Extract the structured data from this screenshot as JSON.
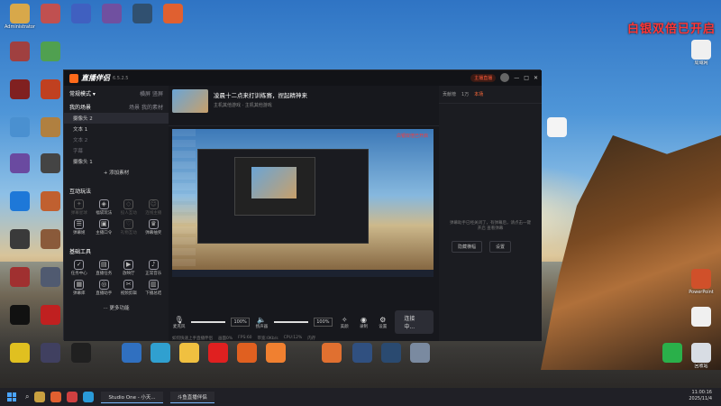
{
  "overlay_text": "白银双倍已开启",
  "desktop_left_icons": [
    {
      "label": "Administrator",
      "color": "#d8a84a"
    },
    {
      "label": "",
      "color": "#c05050"
    },
    {
      "label": "",
      "color": "#4060c0"
    },
    {
      "label": "",
      "color": "#7050a0"
    },
    {
      "label": "",
      "color": "#305070"
    },
    {
      "label": "",
      "color": "#e06030"
    }
  ],
  "desktop_right_icons": [
    {
      "label": "局域网"
    },
    {
      "label": ""
    },
    {
      "label": "PowerPoint"
    },
    {
      "label": ""
    },
    {
      "label": "回收站"
    }
  ],
  "app": {
    "name": "直播伴侣",
    "version": "6.5.2.5",
    "titlebar_promo": "主播直播",
    "titlebar_buttons": [
      "—",
      "□",
      "✕"
    ]
  },
  "left_panel": {
    "mode_label": "常规模式 ▾",
    "mode_tabs": [
      "横屏",
      "竖屏"
    ],
    "scenes_header": "我的场景",
    "scene_tabs": [
      "场景",
      "我的素材"
    ],
    "scenes": [
      {
        "label": "摄像头 2",
        "state": "sel"
      },
      {
        "label": "文本 1",
        "state": ""
      },
      {
        "label": "文本 2",
        "state": "dim"
      },
      {
        "label": "字幕",
        "state": "dim"
      },
      {
        "label": "摄像头 1",
        "state": ""
      }
    ],
    "add_source": "+ 添加素材",
    "interact_title": "互动玩法",
    "interact_tools": [
      {
        "label": "弹幕星球",
        "state": "dim"
      },
      {
        "label": "福袋玩法",
        "state": ""
      },
      {
        "label": "投人互动",
        "state": "dim"
      },
      {
        "label": "连线主播",
        "state": "dim"
      },
      {
        "label": "弹幕姬",
        "state": ""
      },
      {
        "label": "主播口令",
        "state": ""
      },
      {
        "label": "礼物互动",
        "state": "dim"
      },
      {
        "label": "弹幕抽奖",
        "state": ""
      }
    ],
    "basic_title": "基础工具",
    "basic_tools": [
      {
        "label": "任务中心",
        "state": ""
      },
      {
        "label": "直播任务",
        "state": ""
      },
      {
        "label": "放映厅",
        "state": ""
      },
      {
        "label": "正常音乐",
        "state": ""
      },
      {
        "label": "弹幕库",
        "state": ""
      },
      {
        "label": "直播助手",
        "state": ""
      },
      {
        "label": "视频剪辑",
        "state": ""
      },
      {
        "label": "下播总结",
        "state": ""
      }
    ],
    "more": "··· 更多功能"
  },
  "center": {
    "title": "凌晨十二点来打训练赛，捏起精神来",
    "category": "主机其他游戏 · 主机其他游戏",
    "preview_notice": "白银双倍已开启",
    "mic_label": "麦克风",
    "mic_pct": "100%",
    "speaker_label": "扬声器",
    "speaker_pct": "100%",
    "ctrl_icons": [
      "美颜",
      "录制",
      "设置"
    ],
    "start_button": "连接中...",
    "status_items": [
      "如何快速上手直播伴侣",
      "画面0%",
      "FPS:60",
      "带宽:0Kb/s",
      "CPU:12%",
      "内存"
    ]
  },
  "right_panel": {
    "rank_tabs": [
      "贡献榜",
      "1万"
    ],
    "rank_active": "本场",
    "message": "弹幕助手已经关闭了，有弹幕后，请点击一键开启 查看弹幕",
    "buttons": [
      "隐藏横幅",
      "设置"
    ]
  },
  "taskbar": {
    "tasks": [
      "Studio One - 小天...",
      "斗鱼直播伴侣"
    ],
    "time": "11:00:16",
    "date": "2025/11/4"
  }
}
